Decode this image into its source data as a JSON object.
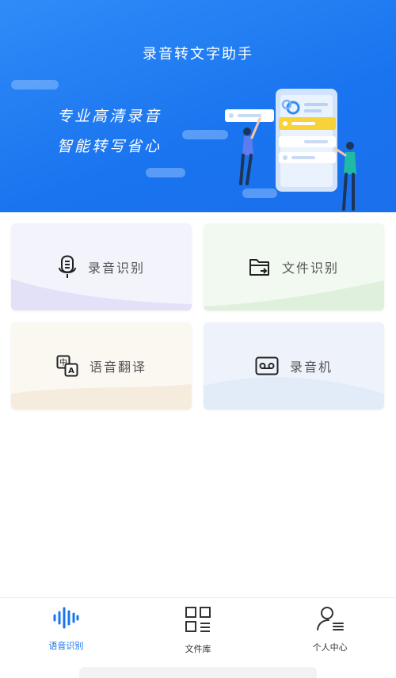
{
  "app": {
    "title": "录音转文字助手"
  },
  "banner": {
    "slogan_line1": "专业高清录音",
    "slogan_line2": "智能转写省心"
  },
  "features": [
    {
      "label": "录音识别",
      "icon": "microphone-icon"
    },
    {
      "label": "文件识别",
      "icon": "folder-import-icon"
    },
    {
      "label": "语音翻译",
      "icon": "translate-icon"
    },
    {
      "label": "录音机",
      "icon": "cassette-recorder-icon"
    }
  ],
  "tabbar": {
    "items": [
      {
        "label": "语音识别",
        "icon": "voice-wave-icon",
        "active": true
      },
      {
        "label": "文件库",
        "icon": "grid-library-icon",
        "active": false
      },
      {
        "label": "个人中心",
        "icon": "user-profile-icon",
        "active": false
      }
    ]
  },
  "colors": {
    "primary": "#1a74ef",
    "accent_yellow": "#f7d23a",
    "figure_teal": "#1fb9a6"
  }
}
